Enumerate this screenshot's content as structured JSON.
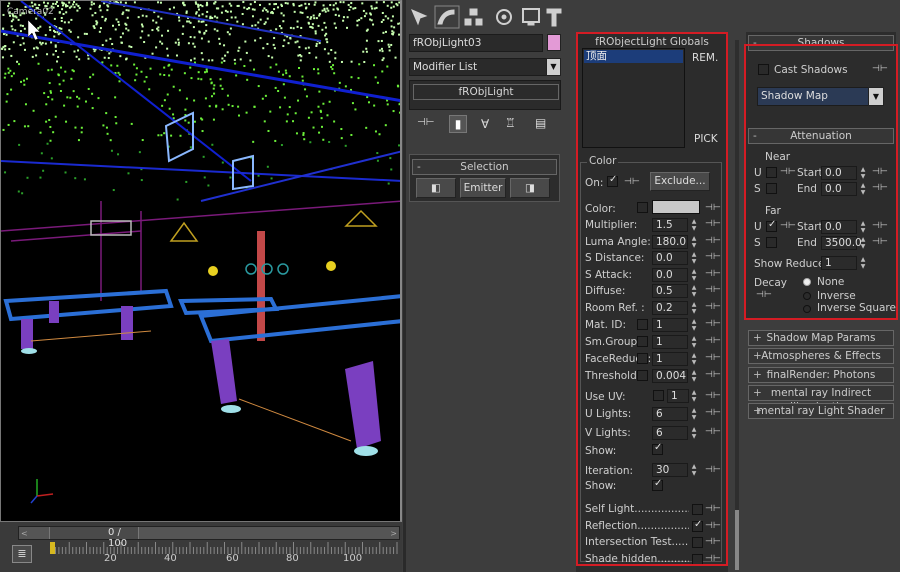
{
  "viewport": {
    "label": "Camera02"
  },
  "timeline": {
    "position_text": "0 / 100",
    "ticks": [
      "20",
      "40",
      "60",
      "80",
      "100"
    ]
  },
  "object": {
    "name": "fRObjLight03",
    "color": "#e39ad6"
  },
  "modifier": {
    "list_label": "Modifier List",
    "stack_item": "fRObjLight"
  },
  "selection": {
    "title": "Selection",
    "emitter_label": "Emitter",
    "toggle": "-"
  },
  "globals": {
    "title": "fRObjectLight Globals",
    "list_item": "顶面",
    "rem_label": "REM.",
    "pick_label": "PICK"
  },
  "color_group": {
    "title": "Color",
    "on_label": "On:",
    "exclude_label": "Exclude...",
    "color_label": "Color:",
    "color_swatch": "#c8c8c8"
  },
  "params": [
    {
      "label": "Multiplier:",
      "value": "1.5"
    },
    {
      "label": "Luma Angle:",
      "value": "180.0"
    },
    {
      "label": "S Distance:",
      "value": "0.0"
    },
    {
      "label": "S Attack:",
      "value": "0.0"
    },
    {
      "label": "Diffuse:",
      "value": "0.5"
    },
    {
      "label": "Room Ref. :",
      "value": "0.2"
    }
  ],
  "params2": [
    {
      "label": "Mat. ID:",
      "value": "1"
    },
    {
      "label": "Sm.Group:",
      "value": "1"
    },
    {
      "label": "FaceReduce:",
      "value": "1"
    },
    {
      "label": "Threshold:",
      "value": "0.004"
    }
  ],
  "use_uv": {
    "label": "Use UV:",
    "value": "1"
  },
  "lights": [
    {
      "label": "U Lights:",
      "value": "6"
    },
    {
      "label": "V Lights:",
      "value": "6"
    }
  ],
  "show1_label": "Show:",
  "iteration": {
    "label": "Iteration:",
    "value": "30"
  },
  "show2_label": "Show:",
  "flags": [
    {
      "label": "Self Light........................",
      "checked": false
    },
    {
      "label": "Reflection.......................",
      "checked": true
    },
    {
      "label": "Intersection Test..........",
      "checked": false
    },
    {
      "label": "Shade hidden..............",
      "checked": false
    }
  ],
  "shadows": {
    "title": "Shadows",
    "cast_label": "Cast Shadows",
    "cast_checked": false,
    "type_value": "Shadow Map"
  },
  "attenuation": {
    "title": "Attenuation",
    "near_label": "Near",
    "far_label": "Far",
    "u_label": "U",
    "s_label": "S",
    "start_label": "Start",
    "end_label": "End",
    "near_start": "0.0",
    "near_end": "0.0",
    "far_start": "0.0",
    "far_end": "3500.0",
    "show_reduce_label": "Show Reduce",
    "show_reduce_value": "1",
    "decay_label": "Decay",
    "decay_options": [
      "None",
      "Inverse",
      "Inverse Square"
    ],
    "decay_selected": "None"
  },
  "rollouts": [
    {
      "pm": "+",
      "label": "Shadow Map Params"
    },
    {
      "pm": "+",
      "label": "Atmospheres & Effects"
    },
    {
      "pm": "+",
      "label": "finalRender: Photons"
    },
    {
      "pm": "+",
      "label": "mental ray Indirect Illumination"
    },
    {
      "pm": "+",
      "label": "mental ray Light Shader"
    }
  ],
  "colors": {
    "highlight": "#d41c24",
    "list_selected": "#1c3d7a",
    "viewport_bg": "#000000"
  }
}
